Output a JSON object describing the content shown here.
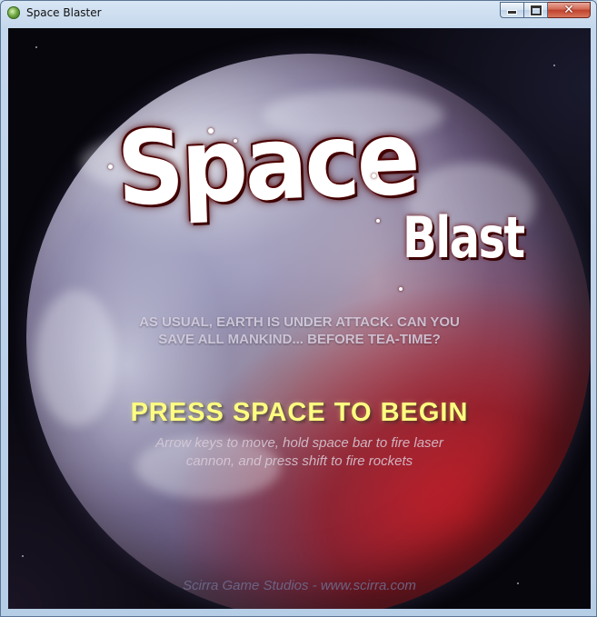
{
  "window": {
    "title": "Space Blaster",
    "controls": {
      "minimize_icon": "minimize-icon",
      "maximize_icon": "maximize-icon",
      "close_icon": "close-icon",
      "close_glyph": "✕"
    }
  },
  "game": {
    "logo": {
      "word1": "Space",
      "word2": "Blast"
    },
    "intro_line1": "AS USUAL, EARTH IS UNDER ATTACK.  CAN YOU",
    "intro_line2": "SAVE ALL MANKIND... BEFORE TEA-TIME?",
    "prompt": "PRESS SPACE TO BEGIN",
    "instructions_line1": "Arrow keys to move, hold space bar to fire laser",
    "instructions_line2": "cannon, and press shift to fire rockets",
    "credits": "Scirra Game Studios - www.scirra.com"
  },
  "colors": {
    "prompt": "#fffd80",
    "intro": "#d6cfe0",
    "credits": "#6e6a8c",
    "logo_outline": "#600000"
  }
}
